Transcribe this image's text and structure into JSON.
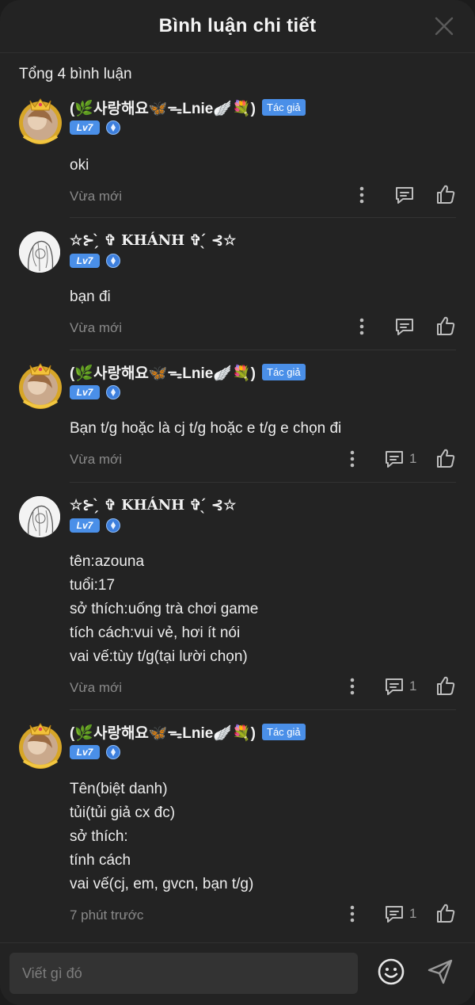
{
  "header": {
    "title": "Bình luận chi tiết"
  },
  "comments_count_label": "Tổng 4 bình luận",
  "comments": [
    {
      "username": "(🌿사랑해요🦋ᯓLnie🪽💐)",
      "is_author": true,
      "author_badge": "Tác giả",
      "level": "Lv7",
      "text": "oki",
      "time": "Vừa mới",
      "reply_count": ""
    },
    {
      "username": "☆⊱ ̗̀ ✞ KHÁNH ✞ ̖́ ⊰☆",
      "is_author": false,
      "author_badge": "",
      "level": "Lv7",
      "text": "bạn đi",
      "time": "Vừa mới",
      "reply_count": ""
    },
    {
      "username": "(🌿사랑해요🦋ᯓLnie🪽💐)",
      "is_author": true,
      "author_badge": "Tác giả",
      "level": "Lv7",
      "text": "Bạn t/g hoặc là cj t/g hoặc e t/g e chọn đi",
      "time": "Vừa mới",
      "reply_count": "1"
    },
    {
      "username": "☆⊱ ̗̀ ✞ KHÁNH ✞ ̖́ ⊰☆",
      "is_author": false,
      "author_badge": "",
      "level": "Lv7",
      "text": "tên:azouna\ntuổi:17\nsở thích:uống trà chơi game\ntích cách:vui vẻ, hơi ít nói\nvai vế:tùy t/g(tại lười chọn)",
      "time": "Vừa mới",
      "reply_count": "1"
    },
    {
      "username": "(🌿사랑해요🦋ᯓLnie🪽💐)",
      "is_author": true,
      "author_badge": "Tác giả",
      "level": "Lv7",
      "text": "Tên(biệt danh)\ntủi(tủi giả cx đc)\nsở thích:\ntính cách\nvai vế(cj, em, gvcn, bạn t/g)",
      "time": "7 phút trước",
      "reply_count": "1"
    }
  ],
  "footer": {
    "input_placeholder": "Viết gì đó"
  },
  "colors": {
    "accent": "#4a8fe8",
    "background": "#232323",
    "muted": "#8a8a8a"
  }
}
